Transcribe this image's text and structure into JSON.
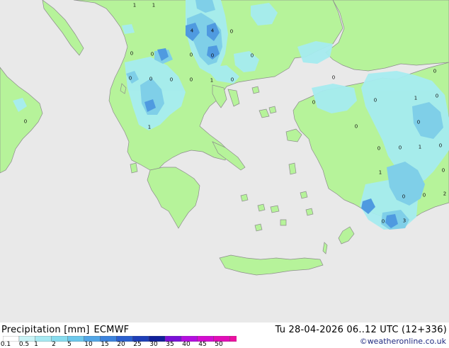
{
  "header": {
    "title": "Precipitation [mm]",
    "model": "ECMWF",
    "valid_time": "Tu 28-04-2026 06..12 UTC (12+336)",
    "credit": "©weatheronline.co.uk"
  },
  "legend": {
    "ticks": [
      "0.1",
      "0.5",
      "1",
      "2",
      "5",
      "10",
      "15",
      "20",
      "25",
      "30",
      "35",
      "40",
      "45",
      "50"
    ],
    "colors": [
      "#ffffff",
      "#c9f3f6",
      "#a7e9f2",
      "#87dcee",
      "#6cc8ec",
      "#52a6e6",
      "#3c83dd",
      "#2a5fcf",
      "#1e3fb8",
      "#10209a",
      "#7a10d8",
      "#b40ee0",
      "#d40cd0",
      "#e20cb8",
      "#ec10a0"
    ]
  },
  "colors": {
    "sea": "#e9e9e9",
    "land": "#b6f39a",
    "rain_light": "#a6ecf0",
    "rain_moderate": "#7fcfe8",
    "rain_heavy": "#4f9ae0",
    "coast": "#9a9a9a"
  },
  "map": {
    "region": "Greece / Aegean Sea",
    "values": [
      {
        "id": "v1",
        "text": "1"
      },
      {
        "id": "v2",
        "text": "1"
      },
      {
        "id": "v3",
        "text": "4"
      },
      {
        "id": "v4",
        "text": "4"
      },
      {
        "id": "v5",
        "text": "0"
      },
      {
        "id": "v6",
        "text": "0"
      },
      {
        "id": "v7",
        "text": "0"
      },
      {
        "id": "v8",
        "text": "0"
      },
      {
        "id": "v9",
        "text": "0"
      },
      {
        "id": "v10",
        "text": "0"
      },
      {
        "id": "v11",
        "text": "0"
      },
      {
        "id": "v12",
        "text": "0"
      },
      {
        "id": "v13",
        "text": "0"
      },
      {
        "id": "v14",
        "text": "0"
      },
      {
        "id": "v15",
        "text": "1"
      },
      {
        "id": "v16",
        "text": "0"
      },
      {
        "id": "v17",
        "text": "0"
      },
      {
        "id": "v18",
        "text": "0"
      },
      {
        "id": "v19",
        "text": "1"
      },
      {
        "id": "v20",
        "text": "0"
      },
      {
        "id": "v21",
        "text": "0"
      },
      {
        "id": "v22",
        "text": "0"
      },
      {
        "id": "v23",
        "text": "0"
      },
      {
        "id": "v24",
        "text": "0"
      },
      {
        "id": "v25",
        "text": "0"
      },
      {
        "id": "v26",
        "text": "1"
      },
      {
        "id": "v27",
        "text": "0"
      },
      {
        "id": "v28",
        "text": "1"
      },
      {
        "id": "v29",
        "text": "0"
      },
      {
        "id": "v30",
        "text": "0"
      },
      {
        "id": "v31",
        "text": "1"
      },
      {
        "id": "v32",
        "text": "0"
      },
      {
        "id": "v33",
        "text": "2"
      },
      {
        "id": "v34",
        "text": "0"
      },
      {
        "id": "v35",
        "text": "3"
      },
      {
        "id": "v36",
        "text": "0"
      },
      {
        "id": "v37",
        "text": "0"
      }
    ]
  }
}
